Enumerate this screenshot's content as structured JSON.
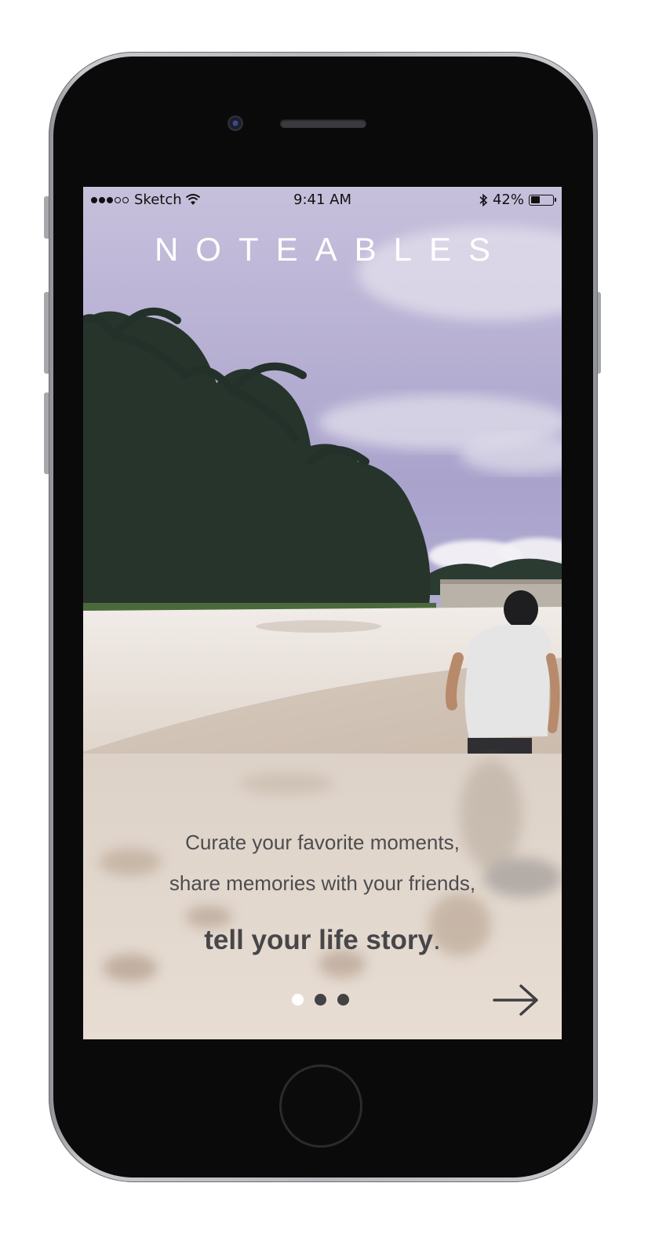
{
  "status_bar": {
    "signal": "●●●○○",
    "carrier": "Sketch",
    "wifi_icon": "wifi-icon",
    "time": "9:41 AM",
    "bluetooth_icon": "bluetooth-icon",
    "battery_percent_label": "42%",
    "battery_level": 0.42
  },
  "app": {
    "title": "NOTEABLES"
  },
  "onboarding": {
    "line1": "Curate your favorite moments,",
    "line2": "share memories with your friends,",
    "line3_bold": "tell your life story",
    "line3_end": ".",
    "pages_total": 3,
    "current_page": 1,
    "next_icon": "arrow-right-icon"
  },
  "colors": {
    "text": "#4d4c4f",
    "title": "#ffffff",
    "dot_inactive": "#434346",
    "dot_active": "#ffffff"
  }
}
